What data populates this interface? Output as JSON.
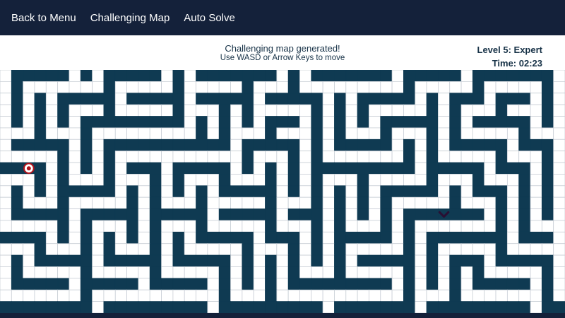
{
  "nav": {
    "back_label": "Back to Menu",
    "challenging_label": "Challenging Map",
    "auto_solve_label": "Auto Solve"
  },
  "status": {
    "message": "Challenging map generated!",
    "hint": "Use WASD or Arrow Keys to move",
    "level": "Level 5: Expert",
    "time": "Time: 02:23"
  },
  "colors": {
    "topbar": "#14213a",
    "wall": "#0f3a52",
    "grid_line": "#c9cfd6",
    "cell": "#ffffff",
    "goal": "#b0121b",
    "player": "#2a0f33"
  },
  "maze": {
    "rows": 21,
    "cols": 49,
    "grid": [
      ".#####.#.#####.#.#######.#.#######.#####.#######.",
      ".#.......#.....#.....#...#.........#.....#.....#.",
      ".#.#.#####.#####.#####.#####.#.#####.#.###.###.#.",
      ".#.#.#...#.....#...#.#.....#.#.#.....#.#...#...#.",
      ".#.#.#.#########.#.#.#.###.#.#.#.#####.#.#####.#.",
      "...#...#.........#.#...#...#.#...#...#.#.....#...",
      ".#####.#.###########.#####.#.#####.#.#.#####.###.",
      ".....#.#.#...........#...#.#.......#.#.....#...#.",
      "####.#.#.#.###.#####.#.#.#.#########.#####.###.#.",
      "...#.#...#...#.#...#...#.#.#...#.....#...#...#.#.",
      ".#.#.#####.#.#.#.#.#####.#.#.#.#.#####.#.###.#.#.",
      ".#...#.....#.#...#.....#...#.#.#.#.....#...#.#.#.",
      ".#####.#####.#####.#####.###.#.#.#.#######.#.#.#.",
      ".....#.#...#.#...#.....#...#.#...#.#.......#.#...",
      "####.#.#.#.#.#.#.#####.###.#.#####.#.#######.###.",
      "...#...#.#...#.#.....#...#.#.#.....#.#.....#.....",
      ".#.#####.#####.#####.#.#.#.#.#.#####.#.###.#####.",
      ".#.....#.....#.....#.#.#.#...#.....#.#.#.#.....#.",
      ".#####.#####.#####.#.#.#.#########.#.#.#.#####.#.",
      ".......#...........#...#...........#...#.......#.",
      "########.#########.#########.#######.#########.##"
    ],
    "goal": {
      "row": 8,
      "col": 2
    },
    "player": {
      "row": 12,
      "col": 38
    }
  }
}
